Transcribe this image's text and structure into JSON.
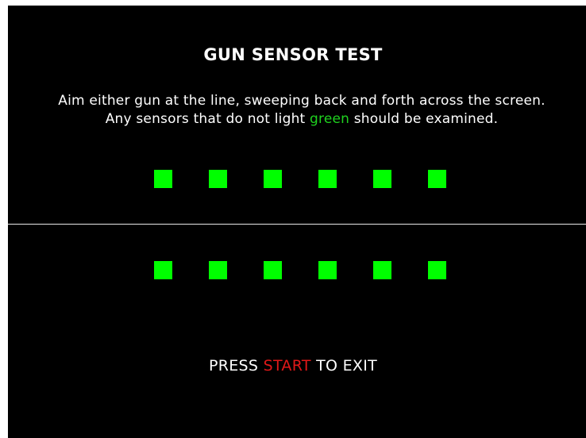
{
  "screen": {
    "title": "GUN SENSOR TEST",
    "instruction_line_1": "Aim either gun at the line, sweeping back and forth across the screen.",
    "instruction_line_2_before": "Any sensors that do not light ",
    "instruction_line_2_highlight": "green",
    "instruction_line_2_after": " should be examined.",
    "exit_before": "PRESS ",
    "exit_highlight": "START",
    "exit_after": " TO EXIT"
  },
  "sensors": {
    "top_row_states": [
      "lit",
      "lit",
      "lit",
      "lit",
      "lit",
      "lit"
    ],
    "bottom_row_states": [
      "lit",
      "lit",
      "lit",
      "lit",
      "lit",
      "lit"
    ]
  },
  "colors": {
    "background": "#000000",
    "text": "#ffffff",
    "sensor_lit": "#00ff00",
    "highlight_green": "#1fd21f",
    "highlight_red": "#e01818",
    "target_line": "#e8e8e8"
  }
}
